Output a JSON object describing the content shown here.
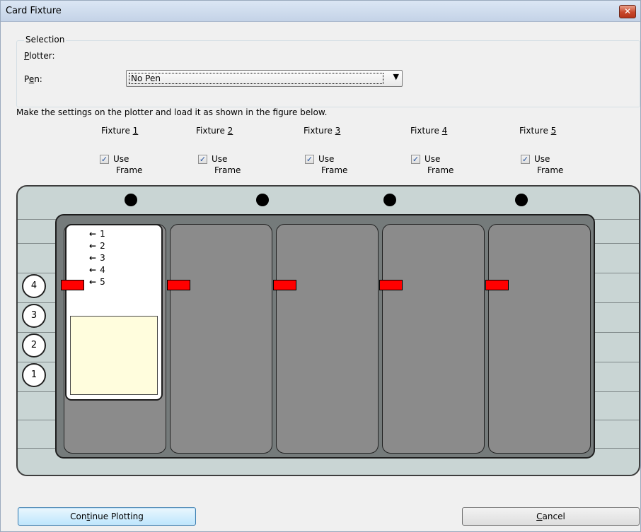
{
  "window": {
    "title": "Card Fixture",
    "close_glyph": "✕"
  },
  "selection": {
    "group_label": "Selection",
    "plotter_label": "Plotter:",
    "plotter_hotkey": "P",
    "pen_label_pre": "P",
    "pen_label_hot": "e",
    "pen_label_post": "n:",
    "pen_value": "No Pen",
    "pen_dropdown_arrow": "▼"
  },
  "instruction": "Make the settings on the plotter and load it as shown in the figure below.",
  "fixtures": [
    {
      "label": "Fixture",
      "number": "1",
      "checked": true,
      "use": "Use",
      "frame": "Frame"
    },
    {
      "label": "Fixture",
      "number": "2",
      "checked": true,
      "use": "Use",
      "frame": "Frame"
    },
    {
      "label": "Fixture",
      "number": "3",
      "checked": true,
      "use": "Use",
      "frame": "Frame"
    },
    {
      "label": "Fixture",
      "number": "4",
      "checked": true,
      "use": "Use",
      "frame": "Frame"
    },
    {
      "label": "Fixture",
      "number": "5",
      "checked": true,
      "use": "Use",
      "frame": "Frame"
    }
  ],
  "check_glyph": "✓",
  "arrow_glyph": "←",
  "diagram": {
    "card_position_labels": [
      "1",
      "2",
      "3",
      "4",
      "5"
    ],
    "side_circles": [
      "4",
      "3",
      "2",
      "1"
    ]
  },
  "buttons": {
    "continue_pre": "Con",
    "continue_hot": "t",
    "continue_post": "inue Plotting",
    "cancel_hot": "C",
    "cancel_post": "ancel"
  },
  "colors": {
    "marker": "#ff0000",
    "card_area": "#fffddd",
    "plate": "#c9d5d4",
    "panel": "#757b7b"
  }
}
